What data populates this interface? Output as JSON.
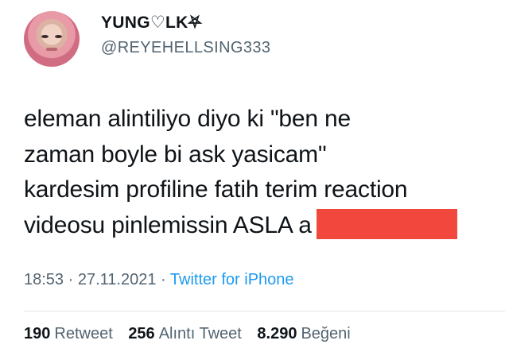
{
  "tweet": {
    "display_name": "YUNG♡LK⛧",
    "handle": "@REYEHELLSING333",
    "text_lines": [
      "eleman alintiliyo diyo ki \"ben ne",
      "zaman boyle bi ask yasicam\"",
      "kardesim profiline fatih terim reaction",
      "videosu pinlemissin ASLA a"
    ],
    "time": "18:53",
    "date": "27.11.2021",
    "separator": "·",
    "source": "Twitter for iPhone",
    "stats": [
      {
        "count": "190",
        "label": "Retweet"
      },
      {
        "count": "256",
        "label": "Alıntı Tweet"
      },
      {
        "count": "8.290",
        "label": "Beğeni"
      }
    ]
  },
  "colors": {
    "text": "#0f1419",
    "secondary": "#536471",
    "link": "#1d9bf0",
    "redaction": "#f2473c"
  }
}
